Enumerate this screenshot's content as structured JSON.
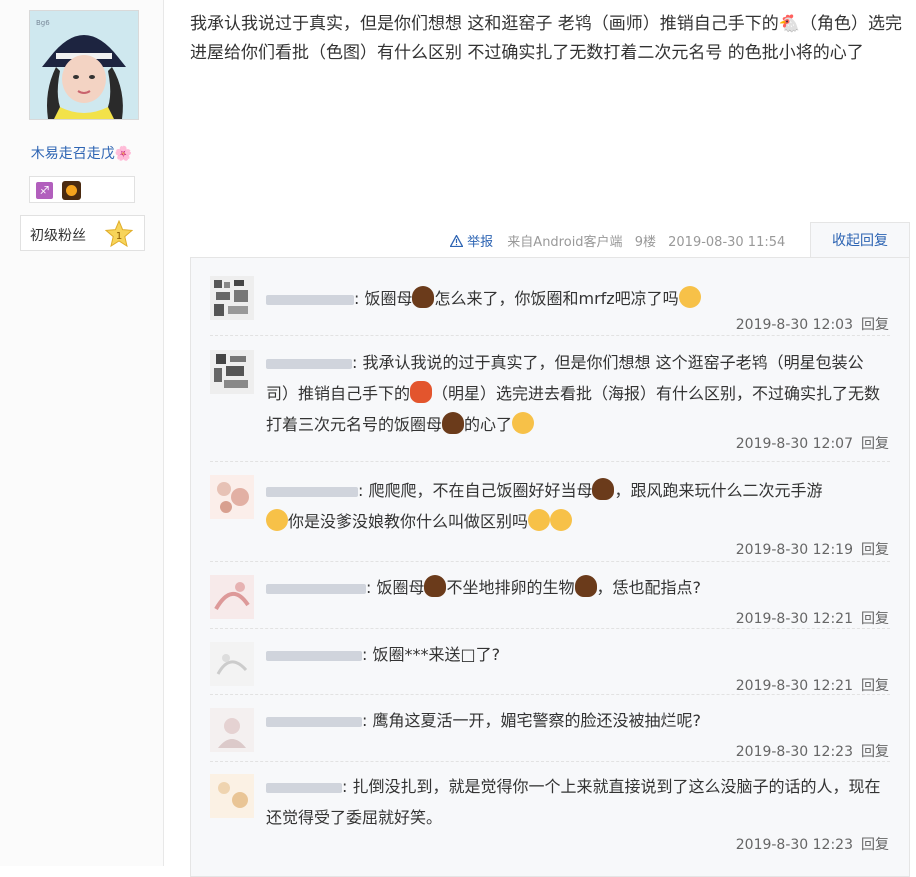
{
  "user": {
    "name": "木易走召走戊🌸",
    "level": "初级粉丝",
    "level_num": "1"
  },
  "post": {
    "text": "我承认我说过于真实，但是你们想想 这和逛窑子 老鸨（画师）推销自己手下的🐔（角色）选完进屋给你们看批（色图）有什么区别 不过确实扎了无数打着二次元名号 的色批小将的心了",
    "report": "举报",
    "source": "来自Android客户端",
    "floor": "9楼",
    "time": "2019-08-30 11:54",
    "collapse": "收起回复"
  },
  "replies": [
    {
      "text_a": ": 饭圈母",
      "text_b": "怎么来了，你饭圈和mrfz吧凉了吗",
      "time": "2019-8-30 12:03",
      "reply": "回复"
    },
    {
      "text_a": ": 我承认我说的过于真实了，但是你们想想 这个逛窑子老鸨（明星包装公司）推销自己手下的",
      "text_b": "（明星）选完进去看批（海报）有什么区别，不过确实扎了无数打着三次元名号的饭圈母",
      "text_c": "的心了",
      "time": "2019-8-30 12:07",
      "reply": "回复"
    },
    {
      "text_a": ": 爬爬爬，不在自己饭圈好好当母",
      "text_b": "，跟风跑来玩什么二次元手游",
      "text_c": "你是没爹没娘教你什么叫做区别吗",
      "time": "2019-8-30 12:19",
      "reply": "回复"
    },
    {
      "text_a": ": 饭圈母",
      "text_b": "不坐地排卵的生物",
      "text_c": "，恁也配指点?",
      "time": "2019-8-30 12:21",
      "reply": "回复"
    },
    {
      "text_a": ": 饭圈***来送□了?",
      "time": "2019-8-30 12:21",
      "reply": "回复"
    },
    {
      "text_a": ": 鹰角这夏活一开，媚宅警察的脸还没被抽烂呢?",
      "time": "2019-8-30 12:23",
      "reply": "回复"
    },
    {
      "text_a": ": 扎倒没扎到，就是觉得你一个上来就直接说到了这么没脑子的话的人，现在还觉得受了委屈就好笑。",
      "time": "2019-8-30 12:23",
      "reply": "回复"
    }
  ],
  "colors": {
    "link": "#2d64b3",
    "meta": "#999999",
    "panel": "#f7f8fa"
  },
  "icons": [
    "warning-icon",
    "star-badge-icon",
    "dog-emoji-icon",
    "chicken-emoji-icon",
    "laugh-emoji-icon",
    "wink-emoji-icon"
  ]
}
